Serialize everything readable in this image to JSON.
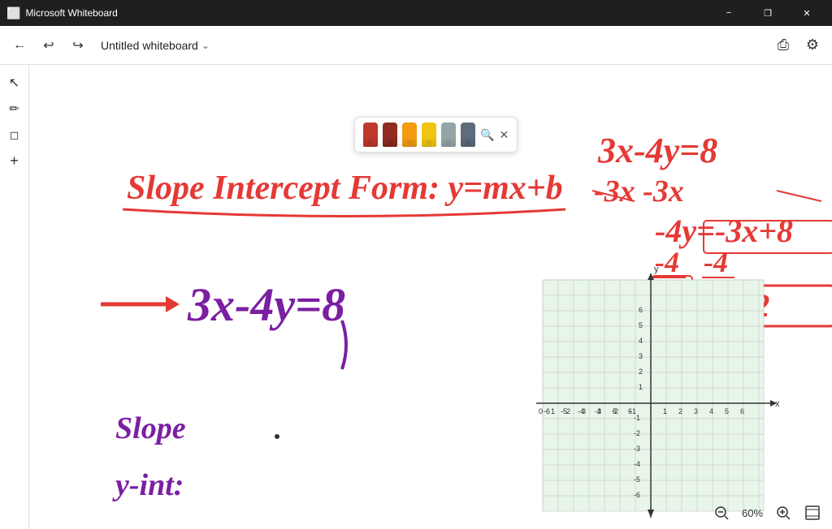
{
  "titlebar": {
    "app_name": "Microsoft Whiteboard",
    "minimize_label": "−",
    "restore_label": "❐",
    "close_label": "✕"
  },
  "toolbar": {
    "back_label": "←",
    "undo_label": "↩",
    "redo_label": "↪",
    "title": "Untitled whiteboard",
    "chevron": "⌄",
    "share_label": "⎙",
    "settings_label": "⚙"
  },
  "tools": {
    "select_label": "↖",
    "pen_label": "✏",
    "eraser_label": "⌫",
    "add_label": "+"
  },
  "color_picker": {
    "colors": [
      "#e74c3c",
      "#e91e63",
      "#ff9800",
      "#ffeb3b",
      "#9e9e9e",
      "#607d8b"
    ],
    "zoom_icon": "🔍",
    "close_label": "✕"
  },
  "zoom": {
    "zoom_out_label": "−",
    "zoom_pct": "60%",
    "zoom_in_label": "+",
    "fit_label": "⛶"
  },
  "whiteboard": {
    "content_description": "Math whiteboard with slope intercept form"
  }
}
